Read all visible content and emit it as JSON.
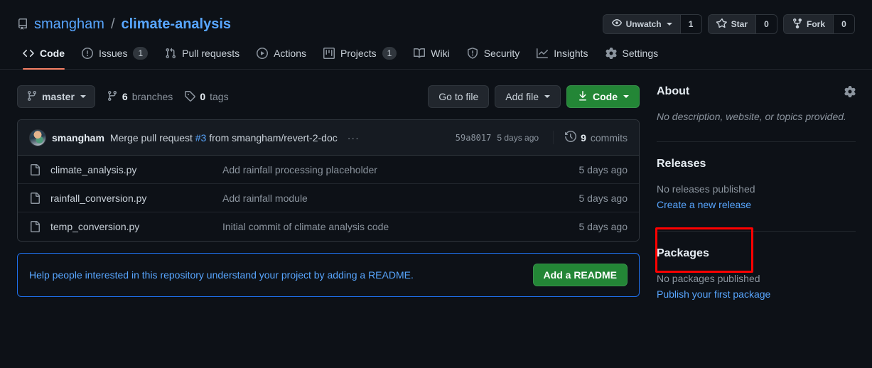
{
  "repo": {
    "owner": "smangham",
    "name": "climate-analysis",
    "icon": "repo-icon"
  },
  "header_actions": {
    "watch": {
      "label": "Unwatch",
      "count": "1",
      "icon": "eye-icon"
    },
    "star": {
      "label": "Star",
      "count": "0",
      "icon": "star-icon"
    },
    "fork": {
      "label": "Fork",
      "count": "0",
      "icon": "fork-icon"
    }
  },
  "nav": {
    "tabs": [
      {
        "label": "Code",
        "icon": "code-icon",
        "count": null,
        "selected": true
      },
      {
        "label": "Issues",
        "icon": "issue-icon",
        "count": "1",
        "selected": false
      },
      {
        "label": "Pull requests",
        "icon": "pr-icon",
        "count": null,
        "selected": false
      },
      {
        "label": "Actions",
        "icon": "play-icon",
        "count": null,
        "selected": false
      },
      {
        "label": "Projects",
        "icon": "project-icon",
        "count": "1",
        "selected": false
      },
      {
        "label": "Wiki",
        "icon": "book-icon",
        "count": null,
        "selected": false
      },
      {
        "label": "Security",
        "icon": "shield-icon",
        "count": null,
        "selected": false
      },
      {
        "label": "Insights",
        "icon": "graph-icon",
        "count": null,
        "selected": false
      },
      {
        "label": "Settings",
        "icon": "gear-icon",
        "count": null,
        "selected": false
      }
    ]
  },
  "branch_bar": {
    "branch": "master",
    "branches_count": "6",
    "branches_label": "branches",
    "tags_count": "0",
    "tags_label": "tags",
    "go_to_file": "Go to file",
    "add_file": "Add file",
    "code": "Code"
  },
  "latest_commit": {
    "author": "smangham",
    "message_prefix": "Merge pull request ",
    "pr_number": "#3",
    "message_suffix": " from smangham/revert-2-doc",
    "more": "···",
    "sha": "59a8017",
    "date": "5 days ago",
    "commits_count": "9",
    "commits_label": "commits"
  },
  "files": [
    {
      "name": "climate_analysis.py",
      "message": "Add rainfall processing placeholder",
      "age": "5 days ago"
    },
    {
      "name": "rainfall_conversion.py",
      "message": "Add rainfall module",
      "age": "5 days ago"
    },
    {
      "name": "temp_conversion.py",
      "message": "Initial commit of climate analysis code",
      "age": "5 days ago"
    }
  ],
  "readme_banner": {
    "text": "Help people interested in this repository understand your project by adding a README.",
    "button": "Add a README"
  },
  "sidebar": {
    "about": {
      "title": "About",
      "description": "No description, website, or topics provided.",
      "settings_icon": "gear-icon"
    },
    "releases": {
      "title": "Releases",
      "empty": "No releases published",
      "link": "Create a new release"
    },
    "packages": {
      "title": "Packages",
      "empty": "No packages published",
      "link": "Publish your first package"
    }
  },
  "colors": {
    "background": "#0d1117",
    "accent_link": "#58a6ff",
    "active_tab_underline": "#f78166",
    "green_button": "#238636",
    "border": "#30363d",
    "banner_border": "#1f6feb",
    "annotation": "#ff0000"
  }
}
